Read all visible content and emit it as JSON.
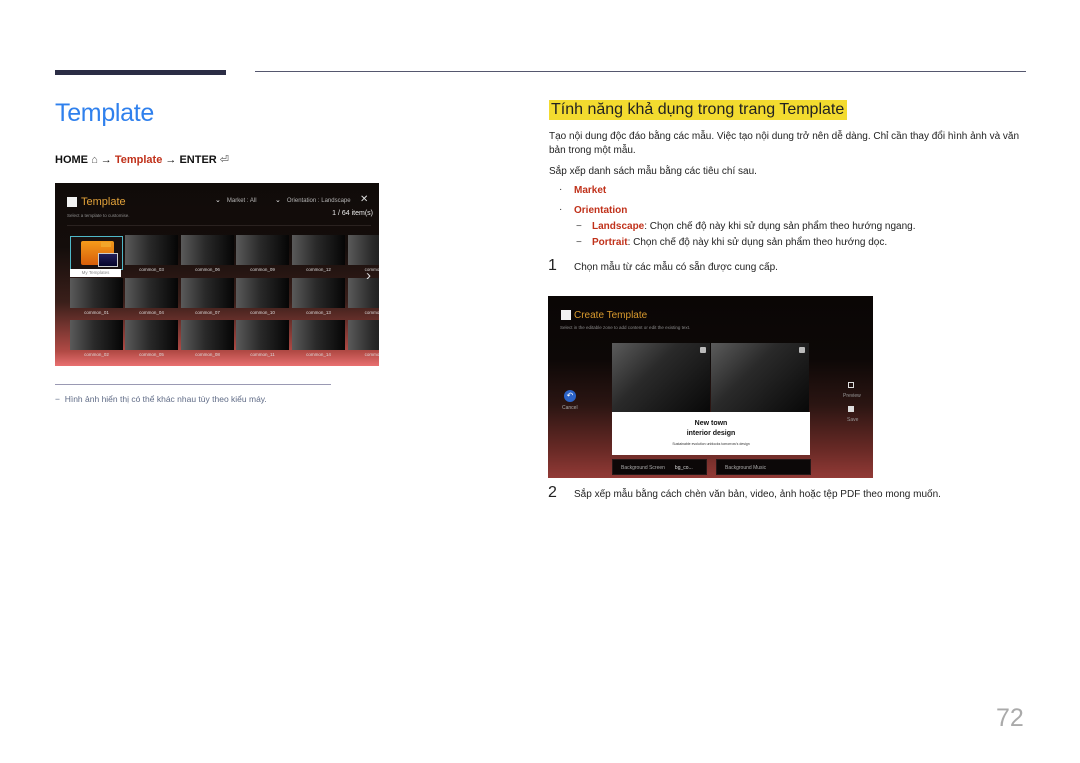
{
  "page": {
    "title": "Template",
    "page_number": "72",
    "breadcrumb": {
      "home": "HOME",
      "home_icon": "⌂",
      "arrow": "→",
      "item": "Template",
      "enter": "ENTER",
      "enter_icon": "⏎"
    },
    "footnote": "Hình ảnh hiển thị có thể khác nhau tùy theo kiểu máy.",
    "footnote_dash": "−"
  },
  "template_screen": {
    "title": "Template",
    "subtitle": "Select a template to customise.",
    "filters": [
      {
        "label": "Market : All"
      },
      {
        "label": "Orientation : Landscape"
      }
    ],
    "close_icon": "✕",
    "count": "1 / 64 item(s)",
    "my_templates_label": "My Templates",
    "next_icon": "›",
    "rows": [
      [
        "common_03",
        "common_06",
        "common_09",
        "common_12",
        "common_"
      ],
      [
        "common_01",
        "common_04",
        "common_07",
        "common_10",
        "common_13",
        "common_"
      ],
      [
        "common_02",
        "common_05",
        "common_08",
        "common_11",
        "common_14",
        "common_"
      ]
    ]
  },
  "right": {
    "section_title": "Tính năng khả dụng trong trang Template",
    "intro": "Tạo nội dung độc đáo bằng các mẫu. Việc tạo nội dung trở nên dễ dàng. Chỉ cần thay đổi hình ảnh và văn bản trong một mẫu.",
    "sort_intro": "Sắp xếp danh sách mẫu bằng các tiêu chí sau.",
    "bullet_glyph": "·",
    "dash_glyph": "−",
    "criteria": [
      {
        "label": "Market"
      },
      {
        "label": "Orientation"
      }
    ],
    "orientation_options": [
      {
        "label": "Landscape",
        "desc": ": Chọn chế độ này khi sử dụng sản phẩm theo hướng ngang."
      },
      {
        "label": "Portrait",
        "desc": ": Chọn chế độ này khi sử dụng sản phẩm theo hướng dọc."
      }
    ],
    "steps": [
      {
        "num": "1",
        "text": "Chọn mẫu từ các mẫu có sẵn được cung cấp."
      },
      {
        "num": "2",
        "text": "Sắp xếp mẫu bằng cách chèn văn bản, video, ảnh hoặc tệp PDF theo mong muốn."
      }
    ]
  },
  "create_screen": {
    "title": "Create Template",
    "subtitle": "Select in the editable zone to add content or edit the existing text.",
    "card_line1": "New town",
    "card_line2": "interior design",
    "card_line3": "Sustainable evolution unblocks tomorrow's design",
    "cancel_label": "Cancel",
    "cancel_icon": "↶",
    "preview_label": "Preview",
    "save_label": "Save",
    "bg_screen_label": "Background Screen",
    "bg_screen_value": "bg_co...",
    "bg_music_label": "Background Music"
  }
}
